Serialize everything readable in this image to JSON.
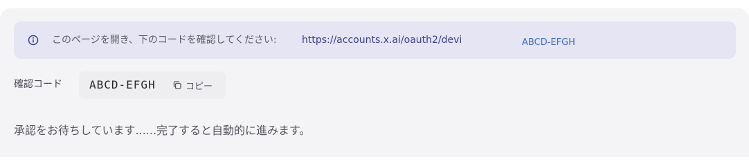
{
  "colors": {
    "panel_bg": "#f4f4f6",
    "banner_bg": "#e5e5f3",
    "link": "#3b3f8c",
    "banner_code": "#3f6fc4"
  },
  "banner": {
    "icon": "info-circle-icon",
    "instruction": "このページを開き、下のコードを確認してください:",
    "url": "https://accounts.x.ai/oauth2/devi",
    "code": "ABCD-EFGH"
  },
  "verification": {
    "label": "確認コード",
    "code": "ABCD-EFGH",
    "copy_icon": "copy-icon",
    "copy_label": "コピー"
  },
  "status": {
    "message": "承認をお待ちしています......完了すると自動的に進みます。"
  }
}
